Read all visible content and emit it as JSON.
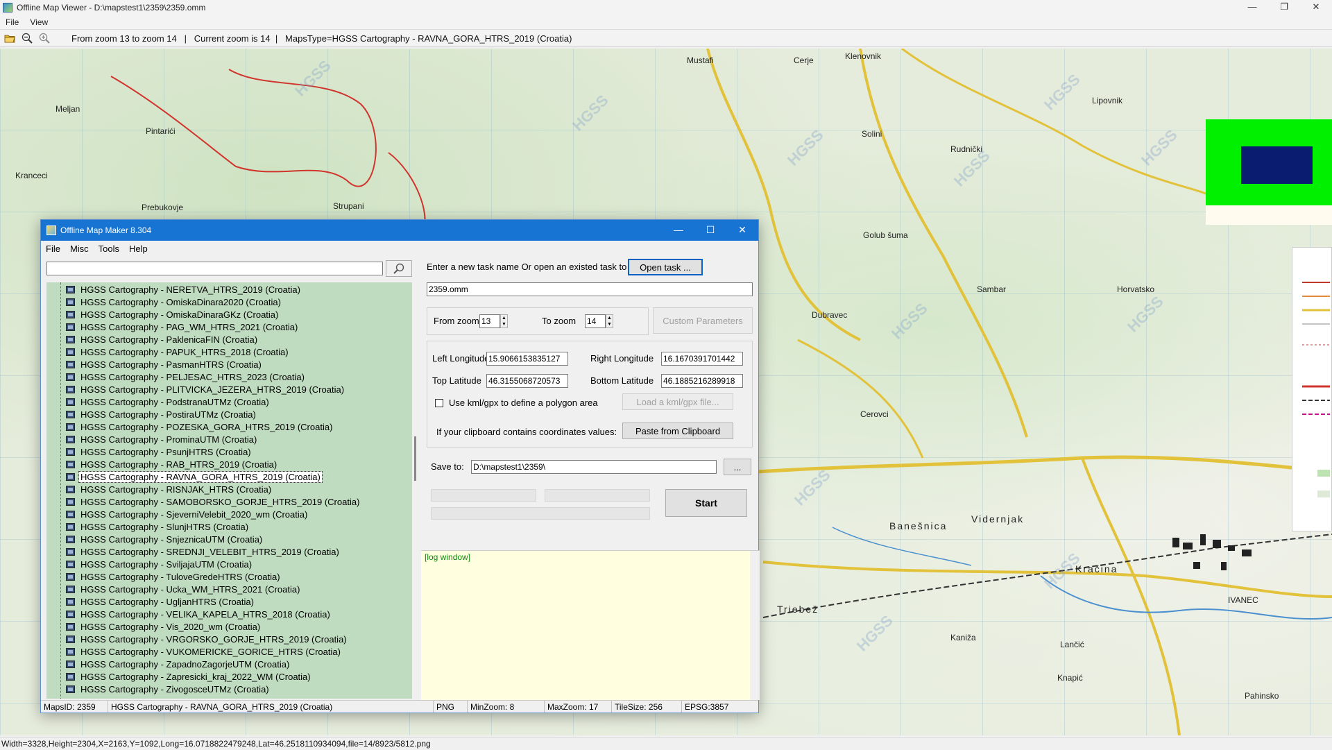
{
  "window": {
    "title": "Offline Map Viewer - D:\\mapstest1\\2359\\2359.omm",
    "minimize": "—",
    "restore": "❐",
    "close": "✕"
  },
  "menu": {
    "file": "File",
    "view": "View"
  },
  "toolbar": {
    "info": "From zoom 13 to zoom 14   |   Current zoom is 14  |   MapsType=HGSS Cartography - RAVNA_GORA_HTRS_2019 (Croatia)"
  },
  "map": {
    "labels": [
      "Klenovnik",
      "Lipovnik",
      "Golub šuma",
      "Horvatsko",
      "Dubravec",
      "Banešnica",
      "Vidernjak",
      "Kračina",
      "IVANEC",
      "Prebukovje",
      "Kranceci",
      "Meljan",
      "Pintarići",
      "Strupani",
      "Sambar",
      "Triebež",
      "Lančić",
      "Knapić",
      "Pahinsko",
      "Cerovci",
      "Rudnički",
      "Solini",
      "Mustafi",
      "Cerje",
      "Kaniža"
    ],
    "watermark": "HGSS",
    "colors": {
      "legend_green": "#00f000",
      "legend_blue": "#0a1c70",
      "road": "#e2c23a",
      "trail": "#d0342c"
    }
  },
  "statusbar": {
    "text": "Width=3328,Height=2304,X=2163,Y=1092,Long=16.0718822479248,Lat=46.2518110934094,file=14/8923/5812.png"
  },
  "dialog": {
    "title": "Offline Map Maker 8.304",
    "minimize": "—",
    "maximize": "☐",
    "close": "✕",
    "menu": [
      "File",
      "Misc",
      "Tools",
      "Help"
    ],
    "search_value": "",
    "tree_items": [
      "HGSS Cartography - NERETVA_HTRS_2019 (Croatia)",
      "HGSS Cartography - OmiskaDinara2020 (Croatia)",
      "HGSS Cartography - OmiskaDinaraGKz (Croatia)",
      "HGSS Cartography - PAG_WM_HTRS_2021 (Croatia)",
      "HGSS Cartography - PaklenicaFIN (Croatia)",
      "HGSS Cartography - PAPUK_HTRS_2018 (Croatia)",
      "HGSS Cartography - PasmanHTRS (Croatia)",
      "HGSS Cartography - PELJESAC_HTRS_2023 (Croatia)",
      "HGSS Cartography - PLITVICKA_JEZERA_HTRS_2019 (Croatia)",
      "HGSS Cartography - PodstranaUTMz (Croatia)",
      "HGSS Cartography - PostiraUTMz (Croatia)",
      "HGSS Cartography - POZESKA_GORA_HTRS_2019 (Croatia)",
      "HGSS Cartography - ProminaUTM (Croatia)",
      "HGSS Cartography - PsunjHTRS (Croatia)",
      "HGSS Cartography - RAB_HTRS_2019 (Croatia)",
      "HGSS Cartography - RAVNA_GORA_HTRS_2019 (Croatia)",
      "HGSS Cartography - RISNJAK_HTRS (Croatia)",
      "HGSS Cartography - SAMOBORSKO_GORJE_HTRS_2019 (Croatia)",
      "HGSS Cartography - SjeverniVelebit_2020_wm (Croatia)",
      "HGSS Cartography - SlunjHTRS (Croatia)",
      "HGSS Cartography - SnjeznicaUTM (Croatia)",
      "HGSS Cartography - SREDNJI_VELEBIT_HTRS_2019 (Croatia)",
      "HGSS Cartography - SviljajaUTM (Croatia)",
      "HGSS Cartography - TuloveGredeHTRS (Croatia)",
      "HGSS Cartography - Ucka_WM_HTRS_2021 (Croatia)",
      "HGSS Cartography - UgljanHTRS (Croatia)",
      "HGSS Cartography - VELIKA_KAPELA_HTRS_2018 (Croatia)",
      "HGSS Cartography - Vis_2020_wm (Croatia)",
      "HGSS Cartography - VRGORSKO_GORJE_HTRS_2019 (Croatia)",
      "HGSS Cartography - VUKOMERICKE_GORICE_HTRS (Croatia)",
      "HGSS Cartography - ZapadnoZagorjeUTM (Croatia)",
      "HGSS Cartography - Zapresicki_kraj_2022_WM (Croatia)",
      "HGSS Cartography - ZivogosceUTMz (Croatia)"
    ],
    "selected_index": 15,
    "task_prompt": "Enter a new task name Or open an existed task to continue:",
    "open_task": "Open task ...",
    "task_name": "2359.omm",
    "from_zoom_label": "From zoom",
    "from_zoom": "13",
    "to_zoom_label": "To zoom",
    "to_zoom": "14",
    "custom_params": "Custom Parameters",
    "left_lon_label": "Left Longitude",
    "left_lon": "15.9066153835127",
    "right_lon_label": "Right Longitude",
    "right_lon": "16.1670391701442",
    "top_lat_label": "Top Latitude",
    "top_lat": "46.3155068720573",
    "bottom_lat_label": "Bottom Latitude",
    "bottom_lat": "46.1885216289918",
    "kml_label": "Use kml/gpx to define a polygon area",
    "kml_checked": false,
    "load_kml": "Load a kml/gpx file...",
    "clipboard_label": "If your clipboard contains coordinates values:",
    "paste_clip": "Paste from Clipboard",
    "save_to_label": "Save to:",
    "save_to": "D:\\mapstest1\\2359\\",
    "browse": "...",
    "start": "Start",
    "log": "[log window]",
    "status": {
      "maps_id": "MapsID: 2359",
      "maps_name": "HGSS Cartography - RAVNA_GORA_HTRS_2019 (Croatia)",
      "format": "PNG",
      "min_zoom": "MinZoom: 8",
      "max_zoom": "MaxZoom: 17",
      "tile_size": "TileSize: 256",
      "epsg": "EPSG:3857"
    }
  }
}
